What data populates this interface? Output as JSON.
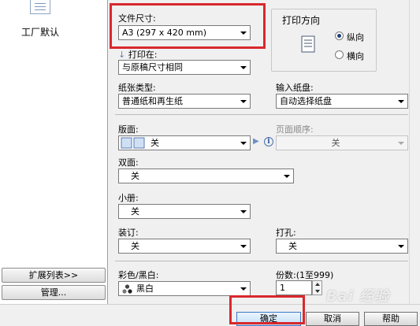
{
  "sidebar": {
    "preset_label": "工厂默认",
    "expand_list_button": "扩展列表>>",
    "manage_button": "管理..."
  },
  "paper_size": {
    "label": "文件尺寸:",
    "value": "A3 (297 x 420 mm)"
  },
  "output_size": {
    "label": "打印在:",
    "value": "与原稿尺寸相同"
  },
  "orientation": {
    "title": "打印方向",
    "options": [
      "纵向",
      "横向"
    ],
    "selected": "纵向"
  },
  "paper_type": {
    "label": "纸张类型:",
    "value": "普通纸和再生纸"
  },
  "input_tray": {
    "label": "输入纸盘:",
    "value": "自动选择纸盘"
  },
  "layout": {
    "label": "版面:",
    "value": "关"
  },
  "page_order": {
    "label": "页面顺序:",
    "value": "关"
  },
  "duplex": {
    "label": "双面:",
    "value": "关"
  },
  "booklet": {
    "label": "小册:",
    "value": "关"
  },
  "binding": {
    "label": "装订:",
    "value": "关"
  },
  "punch": {
    "label": "打孔:",
    "value": "关"
  },
  "color_mode": {
    "label": "彩色/黑白:",
    "value": "黑白"
  },
  "copies": {
    "label": "份数:(1至999)",
    "value": "1"
  },
  "footer": {
    "ok": "确定",
    "cancel": "取消",
    "help": "帮助"
  },
  "watermark": {
    "text": "Bai 经验"
  },
  "colors": {
    "highlight": "#d8282e",
    "accent": "#1e3f7a"
  }
}
